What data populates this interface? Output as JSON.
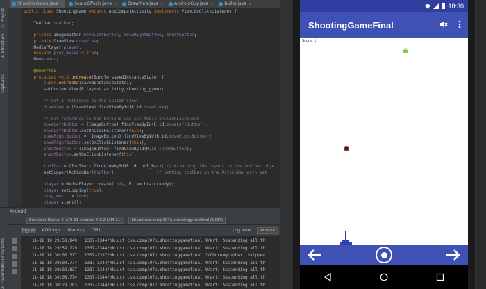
{
  "ide": {
    "tabs": [
      {
        "label": "ShootingGame.java",
        "active": true
      },
      {
        "label": "SoundEffects.java",
        "active": false
      },
      {
        "label": "DrawView.java",
        "active": false
      },
      {
        "label": "AndroidGuy.java",
        "active": false
      },
      {
        "label": "Bullet.java",
        "active": false
      }
    ],
    "side_labels": [
      "1: Project",
      "2: Structure",
      "Captures",
      "Build Variants",
      "2: Favorites"
    ],
    "code_lines": [
      [
        "public class ShootingGame extends AppCompatActivity implements View.OnClickListener {"
      ],
      [
        ""
      ],
      [
        "    Toolbar toolbar;"
      ],
      [
        ""
      ],
      [
        "    private ImageButton moveLeftButton, moveRightButton, shootButton;"
      ],
      [
        "    private DrawView drawView;"
      ],
      [
        "    MediaPlayer player;"
      ],
      [
        "    boolean play_music = true;"
      ],
      [
        "    Menu menu;"
      ],
      [
        ""
      ],
      [
        "    @Override"
      ],
      [
        "    protected void onCreate(Bundle savedInstanceState) {"
      ],
      [
        "        super.onCreate(savedInstanceState);"
      ],
      [
        "        setContentView(R.layout.activity_shooting_game);"
      ],
      [
        ""
      ],
      [
        "        // Get a reference to the Custom View"
      ],
      [
        "        drawView = (DrawView) findViewById(R.id.drawView);"
      ],
      [
        ""
      ],
      [
        "        // Get reference to the buttons and set their onClickListeners"
      ],
      [
        "        moveLeftButton = (ImageButton) findViewById(R.id.moveLeftButton);"
      ],
      [
        "        moveLeftButton.setOnClickListener(this);"
      ],
      [
        "        moveRightButton = (ImageButton) findViewById(R.id.moveRightButton);"
      ],
      [
        "        moveRightButton.setOnClickListener(this);"
      ],
      [
        "        shootButton = (ImageButton) findViewById(R.id.shootButton);"
      ],
      [
        "        shootButton.setOnClickListener(this);"
      ],
      [
        ""
      ],
      [
        "        toolbar = (Toolbar) findViewById(R.id.tool_bar); // Attaching the layout to the toolbar obje"
      ],
      [
        "        setSupportActionBar(toolbar);                // Setting toolbar as the ActionBar with set"
      ],
      [
        ""
      ],
      [
        "        player = MediaPlayer.create(this, R.raw.braincandy);"
      ],
      [
        "        player.setLooping(true);"
      ],
      [
        "        play_music = true;"
      ],
      [
        "        player.start();"
      ]
    ],
    "android_panel_label": "Android",
    "device_combo": "Emulator Nexus_5_API_21 Android 5.0.2 (API 21)",
    "process_combo": "hk.ust.cse.comp107x.shootinggamefinal (1337)",
    "logcat_tabs": [
      "logcat",
      "ADB logs",
      "Memory",
      "CPU"
    ],
    "log_level_label": "Log level:",
    "log_level_value": "Verbose",
    "log_lines": [
      "11-18 18:29:58.940   1337-1344/hk.ust.cse.comp107x.shootinggamefinal W/art: Suspending all th",
      "11-18 18:29:59.229   1337-1344/hk.ust.cse.comp107x.shootinggamefinal W/art: Suspending all th",
      "11-18 18:30:00.317   1337-1337/hk.ust.cse.comp107x.shootinggamefinal I/Choreographer: Skipped",
      "11-18 18:30:00.774   1337-1344/hk.ust.cse.comp107x.shootinggamefinal W/art: Suspending all th",
      "11-18 18:30:02.837   1337-1344/hk.ust.cse.comp107x.shootinggamefinal W/art: Suspending all th",
      "11-18 18:30:08.774   1337-1344/hk.ust.cse.comp107x.shootinggamefinal W/art: Suspending all th",
      "11-18 18:30:29.783   1337-1344/hk.ust.cse.comp107x.shootinggamefinal W/art: Suspending all th"
    ]
  },
  "emulator": {
    "status_time": "18:30",
    "app_title": "ShootingGameFinal",
    "score_text": "Score: 1",
    "icons": {
      "mute": "volume-off-icon",
      "menu": "overflow-menu-icon",
      "left": "arrow-left-icon",
      "shoot": "shoot-circle-icon",
      "right": "arrow-right-icon",
      "back": "nav-back-icon",
      "home": "nav-home-icon",
      "recents": "nav-recents-icon"
    },
    "colors": {
      "primary": "#3f51b5",
      "primary_dark": "#303f9f",
      "android_green": "#8bc34a"
    }
  }
}
